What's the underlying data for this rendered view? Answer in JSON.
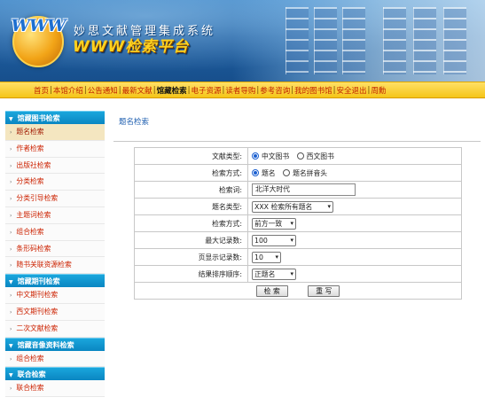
{
  "header": {
    "logo_text": "WWW",
    "system_name": "妙思文献管理集成系统",
    "subtitle": "WWW检索平台"
  },
  "nav": {
    "items": [
      {
        "label": "首页",
        "active": false
      },
      {
        "label": "本馆介绍",
        "active": false
      },
      {
        "label": "公告通知",
        "active": false
      },
      {
        "label": "最新文献",
        "active": false
      },
      {
        "label": "馆藏检索",
        "active": true
      },
      {
        "label": "电子资源",
        "active": false
      },
      {
        "label": "读者导购",
        "active": false
      },
      {
        "label": "参考咨询",
        "active": false
      },
      {
        "label": "我的图书馆",
        "active": false
      },
      {
        "label": "安全退出",
        "active": false
      },
      {
        "label": "周勳",
        "active": false
      }
    ],
    "separator": "|"
  },
  "sidebar": {
    "sections": [
      {
        "title": "馆藏图书检索",
        "items": [
          "题名检索",
          "作者检索",
          "出版社检索",
          "分类检索",
          "分类引导检索",
          "主题词检索",
          "组合检索",
          "条形码检索",
          "随书关联资源检索"
        ]
      },
      {
        "title": "馆藏期刊检索",
        "items": [
          "中文期刊检索",
          "西文期刊检索",
          "二次文献检索"
        ]
      },
      {
        "title": "馆藏音像资料检索",
        "items": [
          "组合检索"
        ]
      },
      {
        "title": "联合检索",
        "items": [
          "联合检索"
        ]
      }
    ],
    "selected": "题名检索"
  },
  "main": {
    "title": "题名检索",
    "form": {
      "doc_type": {
        "label": "文献类型:",
        "options": [
          "中文图书",
          "西文图书"
        ],
        "selected": "中文图书"
      },
      "search_mode": {
        "label": "检索方式:",
        "options": [
          "题名",
          "题名拼音头"
        ],
        "selected": "题名"
      },
      "keyword": {
        "label": "检索词:",
        "value": "北洋大时代"
      },
      "title_type": {
        "label": "题名类型:",
        "value": "XXX 检索所有题名"
      },
      "match_mode": {
        "label": "检索方式:",
        "value": "前方一致"
      },
      "max_records": {
        "label": "最大记录数:",
        "value": "100"
      },
      "page_size": {
        "label": "页显示记录数:",
        "value": "10"
      },
      "sort_order": {
        "label": "结果排序顺序:",
        "value": "正题名"
      },
      "search_button": "检 索",
      "reset_button": "重 写"
    }
  },
  "colors": {
    "banner": "#1f5fa2",
    "navbar": "#f5c518",
    "nav_link": "#c02000",
    "sidebar_header": "#0a86c2",
    "sidebar_link": "#cc2200",
    "selected_item": "#f4e6c0",
    "title_blue": "#1f5fb0"
  }
}
